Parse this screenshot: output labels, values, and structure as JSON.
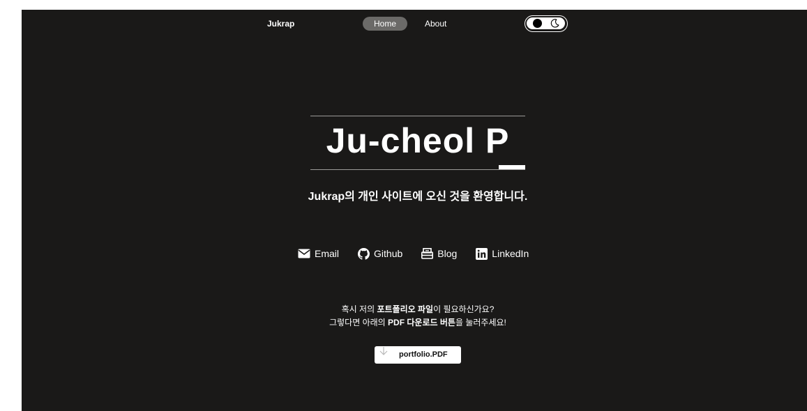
{
  "nav": {
    "brand": "Jukrap",
    "items": [
      {
        "label": "Home",
        "active": true
      },
      {
        "label": "About",
        "active": false
      }
    ],
    "theme_toggle": {
      "icons": [
        "circle-icon",
        "moon-icon"
      ],
      "mode": "dark"
    }
  },
  "hero": {
    "title": "Ju-cheol P",
    "subtitle": "Jukrap의 개인 사이트에 오신 것을 환영합니다."
  },
  "links": [
    {
      "label": "Email",
      "icon": "envelope-icon"
    },
    {
      "label": "Github",
      "icon": "github-icon"
    },
    {
      "label": "Blog",
      "icon": "blog-icon"
    },
    {
      "label": "LinkedIn",
      "icon": "linkedin-icon"
    }
  ],
  "portfolio": {
    "line1_parts": [
      "혹시 저의 ",
      "포트폴리오 파일",
      "이 필요하신가요?"
    ],
    "line2_parts": [
      "그렇다면 아래의 ",
      "PDF 다운로드 버튼",
      "을 눌러주세요!"
    ],
    "button_label": "portfolio.PDF",
    "button_icon": "download-arrow-icon"
  },
  "colors": {
    "background": "#1a1918",
    "text": "#ffffff",
    "nav_active_bg": "#6b6a68",
    "rule": "#9c9b99"
  }
}
